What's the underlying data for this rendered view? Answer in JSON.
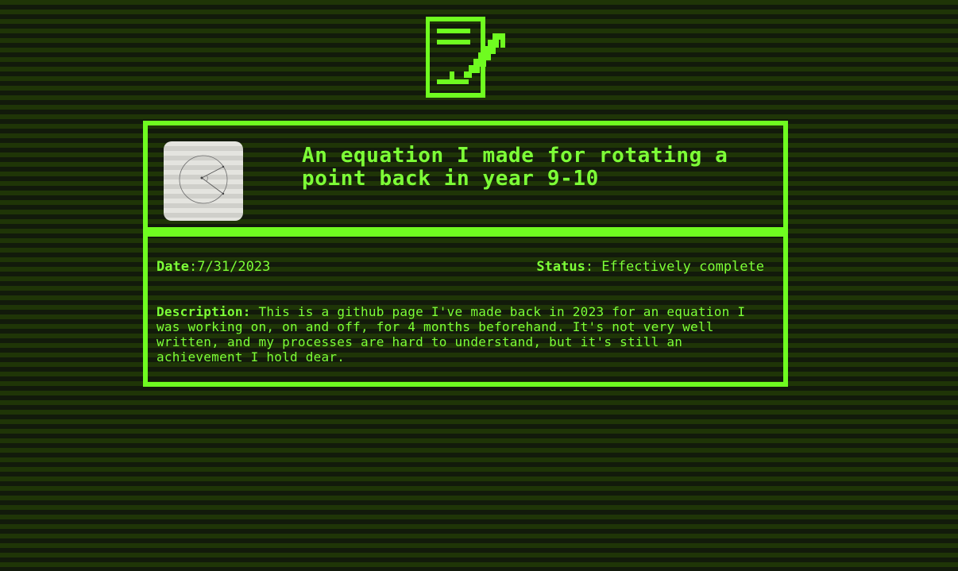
{
  "header": {
    "icon": "document-pen-icon"
  },
  "project": {
    "thumbnail_icon": "rotation-diagram-icon",
    "title": "An equation I made for rotating a point back in year 9-10",
    "date_label": "Date",
    "date_value": "7/31/2023",
    "status_label": "Status",
    "status_value": "Effectively complete",
    "description_label": "Description:",
    "description_text": "This is a github page I've made back in 2023 for an equation I was working on, on and off, for 4 months beforehand. It's not very well written, and my processes are hard to understand, but it's still an achievement I hold dear."
  },
  "colors": {
    "accent": "#7dff37",
    "border": "#6ffc20",
    "stripe_dark": "#121a0b",
    "stripe_light": "#1f3507"
  }
}
